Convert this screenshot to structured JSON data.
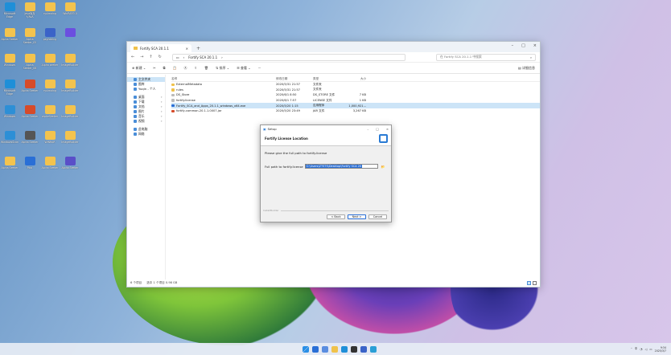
{
  "desktop": {
    "icons": [
      {
        "label": "Microsoft Edge",
        "color": "#1f8fd8"
      },
      {
        "label": "Java库及Y/AVA",
        "color": "#f3c34e"
      },
      {
        "label": "ryuimaing",
        "color": "#f3c34e"
      },
      {
        "label": "WinRAR3.0",
        "color": "#f3c34e"
      },
      {
        "label": "Alpha Seeker",
        "color": "#f3c34e"
      },
      {
        "label": "Alpha Seeker_05",
        "color": "#f3c34e"
      },
      {
        "label": "psyfolding",
        "color": "#3a63c8"
      },
      {
        "label": "",
        "color": "#6b4fe0"
      },
      {
        "label": "Windows",
        "color": "#f3c34e"
      },
      {
        "label": "Alpha Seeker_06",
        "color": "#f3c34e"
      },
      {
        "label": "Alpha seeker",
        "color": "#f3c34e"
      },
      {
        "label": "ImageBuilder",
        "color": "#f3c34e"
      },
      {
        "label": "Microsoft Edge",
        "color": "#1f8fd8"
      },
      {
        "label": "Alpha Seeker",
        "color": "#d64b2a"
      },
      {
        "label": "ryuimaing",
        "color": "#f3c34e"
      },
      {
        "label": "ImageBuilder",
        "color": "#f3c34e"
      },
      {
        "label": "Windows",
        "color": "#2d8fd6"
      },
      {
        "label": "Alpha Seeker",
        "color": "#d64b2a"
      },
      {
        "label": "alpheSeeker",
        "color": "#f3c34e"
      },
      {
        "label": "ImageBuilder",
        "color": "#f3c34e"
      },
      {
        "label": "WindowsScan",
        "color": "#2d8fd6"
      },
      {
        "label": "Alpha Seeker",
        "color": "#555"
      },
      {
        "label": "WINRAR",
        "color": "#f3c34e"
      },
      {
        "label": "ImageBuilder",
        "color": "#f3c34e"
      },
      {
        "label": "Alpha Seeker",
        "color": "#f3c34e"
      },
      {
        "label": "Pico",
        "color": "#2a6fd6"
      },
      {
        "label": "Alpha Seeker",
        "color": "#f3c34e"
      },
      {
        "label": "Alpha Seeker",
        "color": "#5a4fc8"
      }
    ]
  },
  "explorer": {
    "tab_title": "Fortify SCA 20.1.1",
    "path": [
      "Fortify SCA 20.1.1"
    ],
    "search_placeholder": "在 Fortify SCA 20.1.1 中搜索",
    "toolbar": {
      "new": "新建",
      "sort": "排序",
      "view": "查看",
      "more": "···",
      "details": "详细信息"
    },
    "sidebar": [
      {
        "label": "主文件夹",
        "selected": true
      },
      {
        "label": "图库",
        "selected": false
      },
      {
        "label": "Yuqin - 个人",
        "selected": false
      },
      {
        "label": "桌面",
        "selected": false,
        "pinned": true
      },
      {
        "label": "下载",
        "selected": false,
        "pinned": true
      },
      {
        "label": "文档",
        "selected": false,
        "pinned": true
      },
      {
        "label": "图片",
        "selected": false,
        "pinned": true
      },
      {
        "label": "音乐",
        "selected": false,
        "pinned": true
      },
      {
        "label": "视频",
        "selected": false,
        "pinned": true
      },
      {
        "label": "此电脑",
        "selected": false
      },
      {
        "label": "网络",
        "selected": false
      }
    ],
    "columns": [
      "名称",
      "修改日期",
      "类型",
      "大小"
    ],
    "files": [
      {
        "name": "ExternalMetadata",
        "date": "2020/5/31 21:57",
        "type": "文件夹",
        "size": "",
        "icon": "#f0c24b"
      },
      {
        "name": "rules",
        "date": "2020/5/31 21:57",
        "type": "文件夹",
        "size": "",
        "icon": "#f0c24b"
      },
      {
        "name": "DS_Store",
        "date": "2020/6/1 8:50",
        "type": "DS_STORE 文件",
        "size": "7 KB",
        "icon": "#bbbbbb"
      },
      {
        "name": "fortify.license",
        "date": "2020/6/1 7:57",
        "type": "LICENSE 文件",
        "size": "1 KB",
        "icon": "#bbbbbb"
      },
      {
        "name": "Fortify_SCA_and_Apps_20.1.1_windows_x64.exe",
        "date": "2020/5/20 1:15",
        "type": "应用程序",
        "size": "1,000,921...",
        "icon": "#2a6fd6",
        "selected": true
      },
      {
        "name": "fortify-common-20.1.1.0007.jar",
        "date": "2020/5/20 23:49",
        "type": "JAR 文件",
        "size": "3,267 KB",
        "icon": "#d64b2a"
      }
    ],
    "status": {
      "count": "6 个项目",
      "selected": "选中 1 个项目 0.98 GB"
    }
  },
  "dialog": {
    "title": "Setup",
    "heading": "Fortify License Location",
    "prompt": "Please give the full path to fortify.license",
    "field_label": "Full path to fortify.license",
    "field_value": "C:\\Users\\ZTSTS\\Desktop\\Fortify SCA 20",
    "installbuilder": "InstallBuilder",
    "back": "< Back",
    "next": "Next >",
    "cancel": "Cancel"
  },
  "taskbar": {
    "apps": [
      {
        "color": "#2a6fd6"
      },
      {
        "color": "#5a8de0"
      },
      {
        "color": "#f0c24b"
      },
      {
        "color": "#1f8fd8"
      },
      {
        "color": "#333333"
      },
      {
        "color": "#3a63c8"
      },
      {
        "color": "#2a9fd6"
      }
    ],
    "lang": "中",
    "time": "9:34",
    "date": "2025/3/7"
  }
}
